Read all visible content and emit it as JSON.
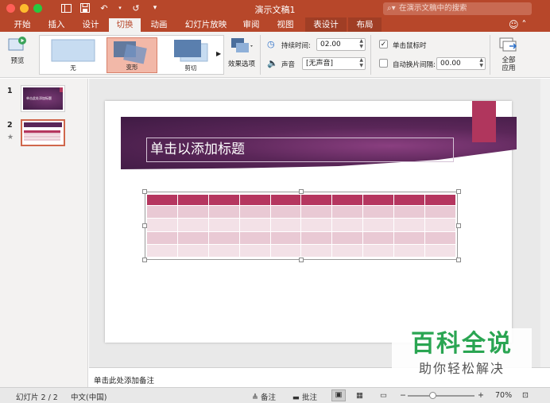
{
  "window": {
    "title": "演示文稿1",
    "search_placeholder": "在演示文稿中的搜索"
  },
  "tabs": [
    "开始",
    "插入",
    "设计",
    "切换",
    "动画",
    "幻灯片放映",
    "审阅",
    "视图",
    "表设计",
    "布局"
  ],
  "ribbon": {
    "preview_label": "预览",
    "transitions": [
      {
        "label": "无",
        "selected": false
      },
      {
        "label": "变形",
        "selected": true
      },
      {
        "label": "剪切",
        "selected": false
      }
    ],
    "effect_options_label": "效果选项",
    "duration_label": "持续时间:",
    "duration_value": "02.00",
    "sound_label": "声音",
    "sound_value": "[无声音]",
    "on_click_label": "单击鼠标时",
    "on_click_checked": true,
    "after_label": "自动换片间隔:",
    "after_value": "00.00",
    "after_checked": false,
    "apply_all_label_1": "全部",
    "apply_all_label_2": "应用"
  },
  "slides_panel": {
    "slides": [
      {
        "number": "1",
        "title": "单击此处添加标题"
      },
      {
        "number": "2",
        "star": "★"
      }
    ]
  },
  "slide": {
    "title_placeholder": "单击以添加标题",
    "table_rows": 5,
    "table_cols": 10
  },
  "notes_placeholder": "单击此处添加备注",
  "status": {
    "slide_counter": "幻灯片 2 / 2",
    "language": "中文(中国)",
    "notes": "备注",
    "comments": "批注",
    "zoom": "70%",
    "zoom_fraction": 0.37
  },
  "watermark": {
    "line1": "百科全说",
    "line2": "助你轻松解决"
  },
  "colors": {
    "accent": "#b7472a",
    "banner": "#5a2658",
    "table_header": "#b5365f",
    "bookmark": "#b0365d"
  }
}
